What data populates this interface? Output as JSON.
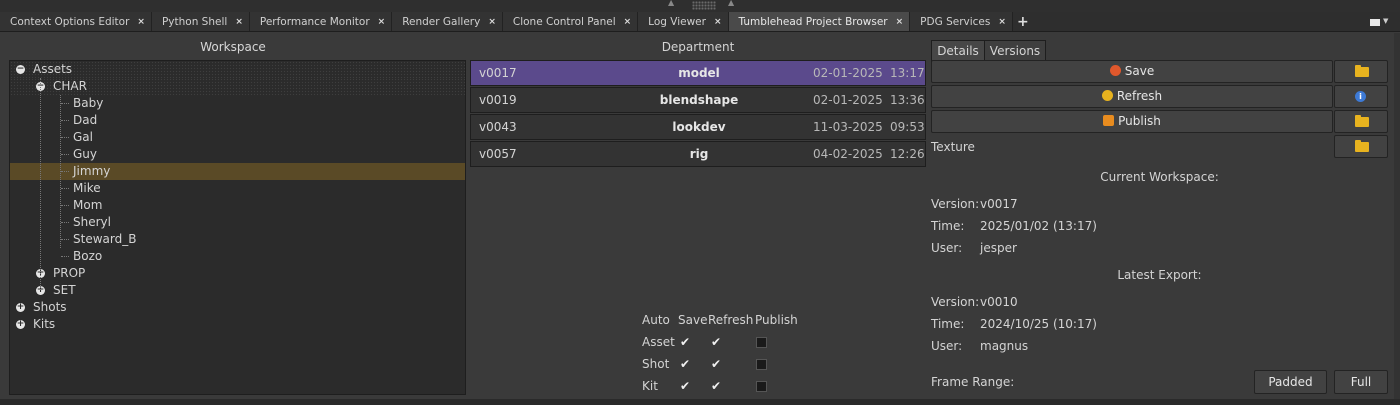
{
  "tabs": [
    {
      "label": "Context Options Editor",
      "active": false
    },
    {
      "label": "Python Shell",
      "active": false
    },
    {
      "label": "Performance Monitor",
      "active": false
    },
    {
      "label": "Render Gallery",
      "active": false
    },
    {
      "label": "Clone Control Panel",
      "active": false
    },
    {
      "label": "Log Viewer",
      "active": false
    },
    {
      "label": "Tumblehead Project Browser",
      "active": true
    },
    {
      "label": "PDG Services",
      "active": false
    }
  ],
  "tab_close_glyph": "×",
  "tab_add_glyph": "+",
  "workspace": {
    "title": "Workspace",
    "tree": [
      {
        "label": "Assets",
        "expander": "−"
      },
      {
        "label": "CHAR",
        "expander": "−"
      },
      {
        "label": "Baby"
      },
      {
        "label": "Dad"
      },
      {
        "label": "Gal"
      },
      {
        "label": "Guy"
      },
      {
        "label": "Jimmy",
        "selected": true
      },
      {
        "label": "Mike"
      },
      {
        "label": "Mom"
      },
      {
        "label": "Sheryl"
      },
      {
        "label": "Steward_B"
      },
      {
        "label": "Bozo"
      },
      {
        "label": "PROP",
        "expander": "+"
      },
      {
        "label": "SET",
        "expander": "+"
      },
      {
        "label": "Shots",
        "expander": "+"
      },
      {
        "label": "Kits",
        "expander": "+"
      }
    ]
  },
  "department": {
    "title": "Department",
    "versions": [
      {
        "version": "v0017",
        "name": "model",
        "date": "02-01-2025",
        "time": "13:17",
        "selected": true
      },
      {
        "version": "v0019",
        "name": "blendshape",
        "date": "02-01-2025",
        "time": "13:36",
        "selected": false
      },
      {
        "version": "v0043",
        "name": "lookdev",
        "date": "11-03-2025",
        "time": "09:53",
        "selected": false
      },
      {
        "version": "v0057",
        "name": "rig",
        "date": "04-02-2025",
        "time": "12:26",
        "selected": false
      }
    ],
    "auto": {
      "headers": {
        "auto": "Auto",
        "save": "Save",
        "refresh": "Refresh",
        "publish": "Publish"
      },
      "rows": [
        {
          "label": "Asset",
          "save": true,
          "refresh": true,
          "publish": false
        },
        {
          "label": "Shot",
          "save": true,
          "refresh": true,
          "publish": false
        },
        {
          "label": "Kit",
          "save": true,
          "refresh": true,
          "publish": false
        }
      ],
      "check_glyph": "✔"
    }
  },
  "details": {
    "tabs": {
      "details": "Details",
      "versions": "Versions"
    },
    "buttons": {
      "save": "Save",
      "refresh": "Refresh",
      "publish": "Publish"
    },
    "icon_colors": {
      "save": "#e0582c",
      "refresh": "#e8b31f",
      "publish": "#e88c1f",
      "folder": "#e8b31f",
      "info": "#3d7ad6"
    },
    "texture_label": "Texture",
    "current_workspace": {
      "heading": "Current Workspace:",
      "version_label": "Version:",
      "version": "v0017",
      "time_label": "Time:",
      "time": "2025/01/02 (13:17)",
      "user_label": "User:",
      "user": "jesper"
    },
    "latest_export": {
      "heading": "Latest Export:",
      "version_label": "Version:",
      "version": "v0010",
      "time_label": "Time:",
      "time": "2024/10/25 (10:17)",
      "user_label": "User:",
      "user": "magnus"
    },
    "frame_range": {
      "label": "Frame Range:",
      "padded": "Padded",
      "full": "Full"
    }
  },
  "colors": {
    "selected_tree_row": "#5a4a26",
    "selected_version_row": "#5b4a8c"
  }
}
